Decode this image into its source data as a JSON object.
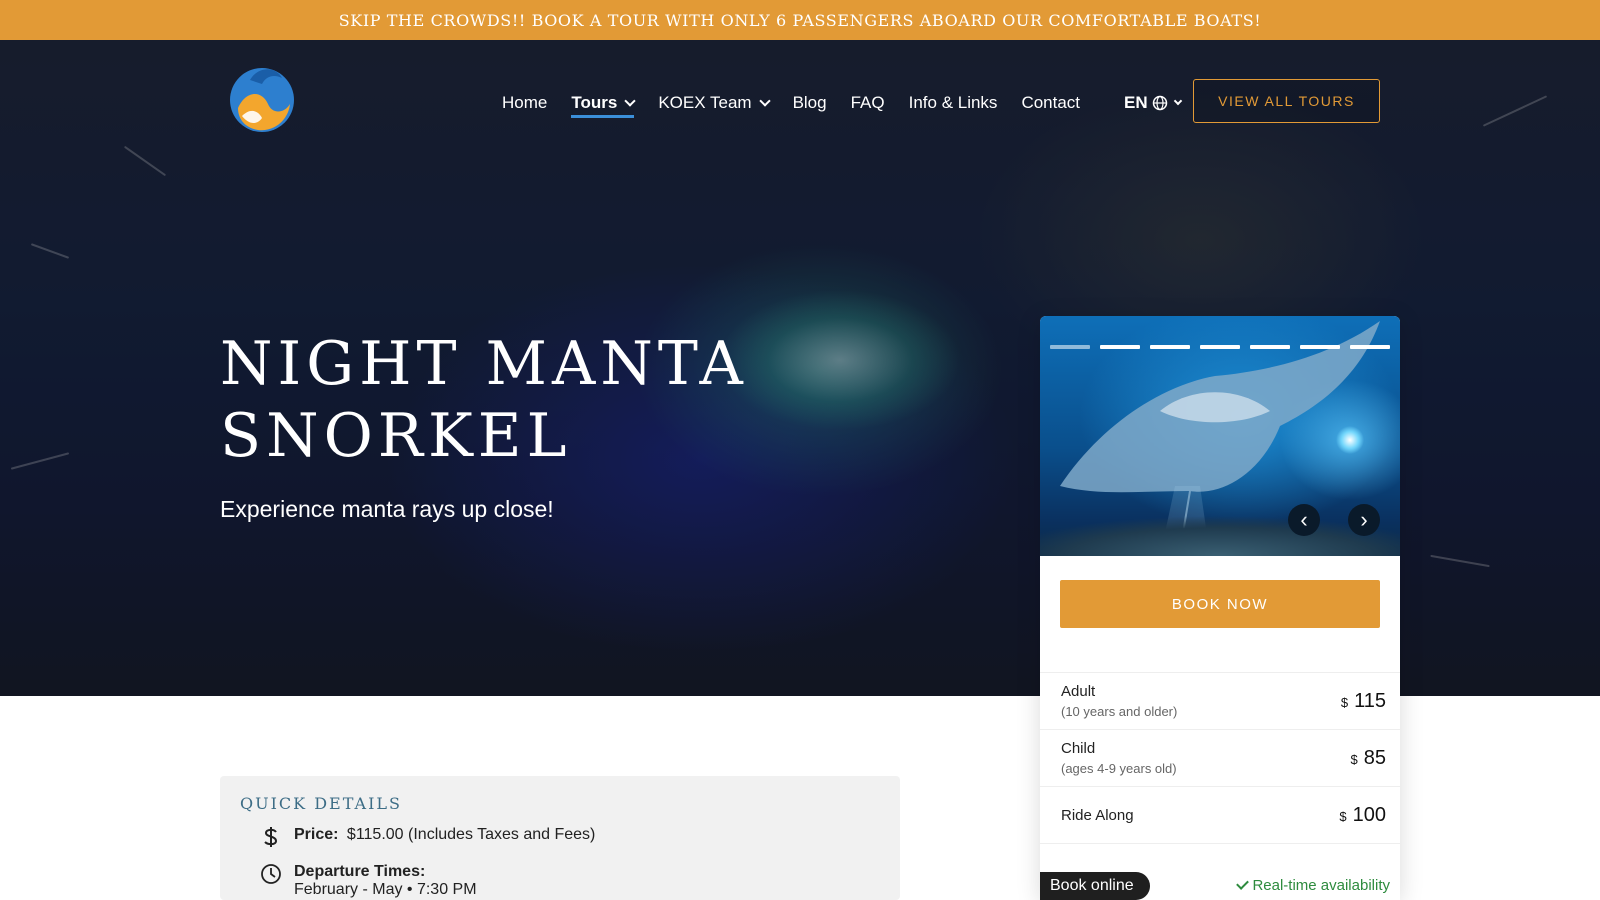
{
  "banner": {
    "text": "Skip the Crowds!! Book a tour with only 6 passengers aboard our comfortable boats!"
  },
  "nav": {
    "items": [
      {
        "label": "Home",
        "dropdown": false,
        "active": false
      },
      {
        "label": "Tours",
        "dropdown": true,
        "active": true
      },
      {
        "label": "KOEX Team",
        "dropdown": true,
        "active": false
      },
      {
        "label": "Blog",
        "dropdown": false,
        "active": false
      },
      {
        "label": "FAQ",
        "dropdown": false,
        "active": false
      },
      {
        "label": "Info & Links",
        "dropdown": false,
        "active": false
      },
      {
        "label": "Contact",
        "dropdown": false,
        "active": false
      }
    ],
    "language": "EN",
    "cta_label": "View All Tours"
  },
  "hero": {
    "title_line1": "Night Manta",
    "title_line2": "Snorkel",
    "subtitle": "Experience manta rays up close!"
  },
  "booking": {
    "gallery": {
      "slide_count": 7,
      "current_slide": 1,
      "prev_icon": "‹",
      "next_icon": "›"
    },
    "book_now_label": "Book Now",
    "prices": [
      {
        "label": "Adult",
        "note": "(10 years and older)",
        "currency": "$",
        "amount": "115"
      },
      {
        "label": "Child",
        "note": "(ages 4-9 years old)",
        "currency": "$",
        "amount": "85"
      },
      {
        "label": "Ride Along",
        "note": "",
        "currency": "$",
        "amount": "100"
      }
    ],
    "book_online_label": "Book online",
    "availability_label": "Real-time availability"
  },
  "quick_details": {
    "title": "Quick Details",
    "price_label": "Price:",
    "price_value": "$115.00 (Includes Taxes and Fees)",
    "departure_label": "Departure Times:",
    "departure_value": "February - May • 7:30 PM"
  },
  "colors": {
    "accent": "#e29a36",
    "nav_underline": "#3b8fd9",
    "availability": "#2e8b3e"
  }
}
